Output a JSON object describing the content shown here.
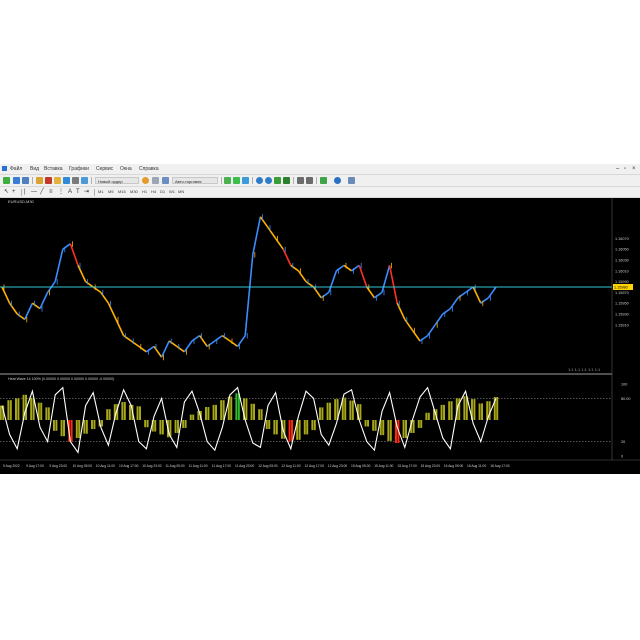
{
  "menu": [
    "Файл",
    "Вид",
    "Вставка",
    "Графики",
    "Сервис",
    "Окна",
    "Справка"
  ],
  "toolbar": {
    "new_order_label": "Новый ордер",
    "autotrading_label": "Авто-торговля"
  },
  "timeframes": [
    "M1",
    "M5",
    "M15",
    "M30",
    "H1",
    "H4",
    "D1",
    "W1",
    "MN"
  ],
  "chart": {
    "title": "EURUSD,M30",
    "indicator_label": "Heat Wave 14 100% (0.00000 0.00000 0.00000 0.00000 -0.00000)",
    "price_labels": [
      "1.16070",
      "1.16050",
      "1.16030",
      "1.16010",
      "1.15990",
      "1.15970",
      "1.15950",
      "1.15930",
      "1.15910"
    ],
    "current_price": "1.15980",
    "corner_text": "1:1 1:1 1:1  1:1 1:1",
    "indicator_axis": [
      "100",
      "80.00",
      "20",
      "0"
    ],
    "time_labels": [
      "9 Aug 2022",
      "9 Aug 17:00",
      "9 Aug 23:00",
      "10 Aug 05:00",
      "10 Aug 11:00",
      "10 Aug 17:00",
      "10 Aug 23:00",
      "11 Aug 05:00",
      "11 Aug 11:00",
      "11 Aug 17:00",
      "11 Aug 23:00",
      "12 Aug 05:00",
      "12 Aug 11:00",
      "12 Aug 17:00",
      "12 Aug 23:00",
      "15 Aug 05:00",
      "15 Aug 11:00",
      "15 Aug 17:00",
      "15 Aug 23:00",
      "16 Aug 05:00",
      "16 Aug 11:00",
      "16 Aug 17:00"
    ],
    "colors": {
      "background": "#000000",
      "level_line": "#33c6d8",
      "price_blue": "#3b8cff",
      "price_orange": "#ffb000",
      "price_red": "#ff3020",
      "hist_olive": "#a8a818",
      "hist_green": "#2fbf2f",
      "hist_red": "#ff2a10",
      "wave_white": "#ffffff"
    }
  },
  "chart_data": {
    "type": "line",
    "title": "EURUSD,M30",
    "series": [
      {
        "name": "EURUSD,M30",
        "values": [
          1.1598,
          1.1595,
          1.1593,
          1.1592,
          1.1595,
          1.1594,
          1.1597,
          1.1599,
          1.1605,
          1.1606,
          1.1602,
          1.1599,
          1.1598,
          1.1597,
          1.1595,
          1.1592,
          1.1589,
          1.1588,
          1.1587,
          1.1586,
          1.1587,
          1.1585,
          1.1588,
          1.1587,
          1.1586,
          1.1588,
          1.1589,
          1.1587,
          1.1588,
          1.1589,
          1.1588,
          1.1587,
          1.1589,
          1.1604,
          1.1611,
          1.1609,
          1.1607,
          1.1605,
          1.1602,
          1.1601,
          1.1599,
          1.1598,
          1.1596,
          1.1597,
          1.1601,
          1.1602,
          1.1601,
          1.1602,
          1.1598,
          1.1596,
          1.1597,
          1.1602,
          1.1595,
          1.1592,
          1.159,
          1.1588,
          1.1589,
          1.1591,
          1.1593,
          1.1594,
          1.1596,
          1.1597,
          1.1598,
          1.1595,
          1.1596,
          1.1598
        ]
      }
    ],
    "current_price": 1.1598,
    "ylim": [
      1.1583,
      1.1613
    ],
    "indicator": {
      "name": "Heat Wave",
      "levels": [
        100,
        80,
        20,
        0
      ],
      "histogram": [
        40,
        55,
        60,
        70,
        62,
        48,
        35,
        -30,
        -45,
        -60,
        -50,
        -38,
        -25,
        -18,
        30,
        44,
        50,
        42,
        38,
        -20,
        -32,
        -40,
        -48,
        -36,
        -22,
        15,
        25,
        36,
        42,
        55,
        65,
        74,
        60,
        45,
        30,
        -25,
        -40,
        -52,
        -60,
        -55,
        -40,
        -28,
        35,
        48,
        58,
        62,
        54,
        44,
        -18,
        -30,
        -42,
        -58,
        -64,
        -50,
        -36,
        -22,
        20,
        30,
        42,
        52,
        60,
        66,
        58,
        46,
        52,
        64
      ],
      "wave": [
        70,
        30,
        10,
        60,
        90,
        40,
        20,
        85,
        95,
        20,
        5,
        70,
        88,
        40,
        15,
        60,
        92,
        70,
        20,
        10,
        55,
        80,
        30,
        12,
        75,
        90,
        60,
        20,
        8,
        40,
        85,
        95,
        50,
        18,
        12,
        70,
        88,
        35,
        10,
        55,
        90,
        80,
        30,
        15,
        45,
        86,
        92,
        50,
        20,
        8,
        62,
        88,
        40,
        12,
        50,
        82,
        95,
        60,
        25,
        10,
        70,
        90,
        45,
        20,
        55,
        80
      ]
    }
  }
}
